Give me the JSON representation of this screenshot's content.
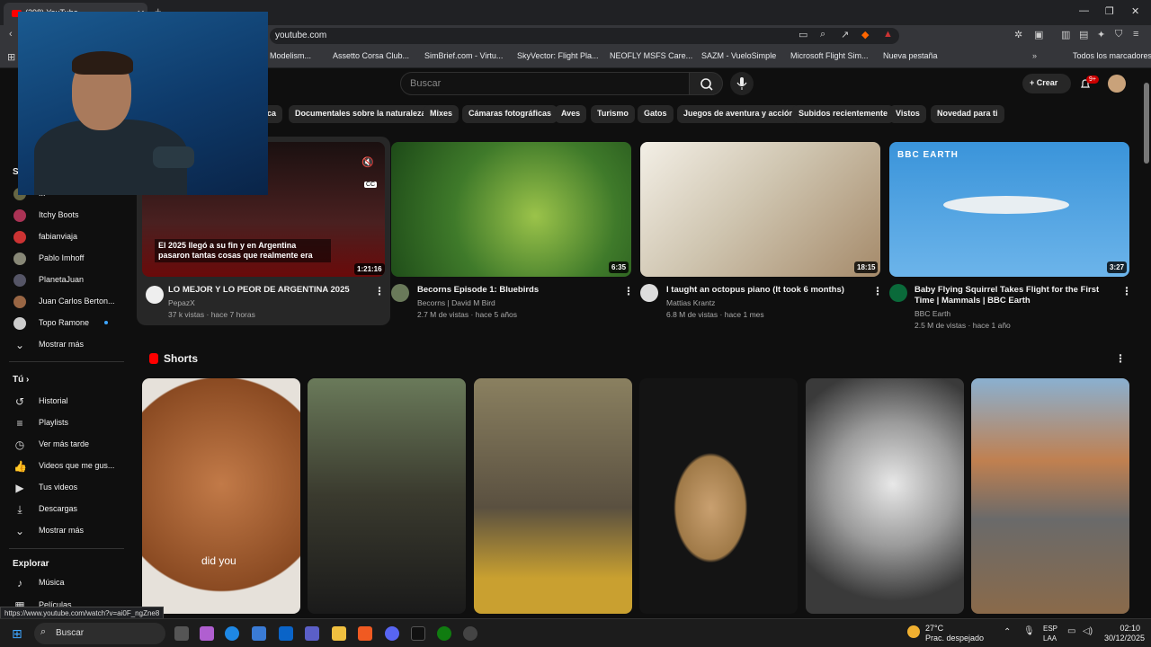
{
  "browser": {
    "tab_title": "(298) YouTube",
    "url": "youtube.com",
    "bookmarks": [
      "Modelism...",
      "Assetto Corsa Club...",
      "SimBrief.com - Virtu...",
      "SkyVector: Flight Pla...",
      "NEOFLY MSFS Care...",
      "SAZM - VueloSimple",
      "Microsoft Flight Sim...",
      "Nueva pestaña",
      "Todos los marcadores"
    ],
    "status_url": "https://www.youtube.com/watch?v=ai0F_ngZne8"
  },
  "header": {
    "search_placeholder": "Buscar",
    "create_label": "Crear",
    "notif_count": "9+"
  },
  "chips": [
    "...ica",
    "Documentales sobre la naturaleza",
    "Mixes",
    "Cámaras fotográficas",
    "Aves",
    "Turismo",
    "Gatos",
    "Juegos de aventura y acción",
    "Subidos recientemente",
    "Vistos",
    "Novedad para ti"
  ],
  "sidebar": {
    "subs_header": "S",
    "subs": [
      "...",
      "Itchy Boots",
      "fabianviaja",
      "Pablo Imhoff",
      "PlanetaJuan",
      "Juan Carlos Berton...",
      "Topo Ramone"
    ],
    "subs_more": "Mostrar más",
    "you_header": "Tú",
    "you_items": [
      "Historial",
      "Playlists",
      "Ver más tarde",
      "Videos que me gus...",
      "Tus videos",
      "Descargas",
      "Mostrar más"
    ],
    "explore_header": "Explorar",
    "explore_items": [
      "Música",
      "Películas"
    ]
  },
  "videos": [
    {
      "title": "LO MEJOR Y LO PEOR DE ARGENTINA 2025",
      "channel": "PepazX",
      "meta": "37 k vistas · hace 7 horas",
      "duration": "1:21:16",
      "overlay": "El 2025 llegó a su fin y en Argentina pasaron tantas cosas que realmente era",
      "thumb_color": "#3a1a1a"
    },
    {
      "title": "Becorns Episode 1: Bluebirds",
      "channel": "Becorns | David M Bird",
      "meta": "2.7 M de vistas · hace 5 años",
      "duration": "6:35",
      "thumb_color": "#3f7a2a"
    },
    {
      "title": "I taught an octopus piano (It took 6 months)",
      "channel": "Mattias Krantz",
      "meta": "6.8 M de vistas · hace 1 mes",
      "duration": "18:15",
      "thumb_color": "#c9bfae"
    },
    {
      "title": "Baby Flying Squirrel Takes Flight for the First Time | Mammals | BBC Earth",
      "channel": "BBC Earth",
      "meta": "2.5 M de vistas · hace 1 año",
      "duration": "3:27",
      "brand": "BBC EARTH",
      "thumb_color": "#4aa0e0"
    }
  ],
  "shorts": {
    "title": "Shorts",
    "items": [
      {
        "caption": "did you",
        "color": "#b5683a"
      },
      {
        "caption": "",
        "color": "#4a4a3a"
      },
      {
        "caption": "",
        "color": "#6a6050"
      },
      {
        "caption": "",
        "color": "#1a1a1a"
      },
      {
        "caption": "",
        "color": "#5a5a5a"
      },
      {
        "caption": "",
        "color": "#7a5a3a"
      }
    ]
  },
  "taskbar": {
    "search": "Buscar",
    "temp": "27°C",
    "weather": "Prac. despejado",
    "lang1": "ESP",
    "lang2": "LAA",
    "time": "02:10",
    "date": "30/12/2025"
  }
}
